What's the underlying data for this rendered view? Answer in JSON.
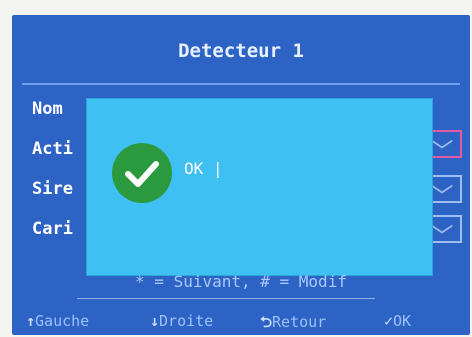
{
  "screen": {
    "title": "Detecteur 1",
    "rows": [
      {
        "label": "Nom"
      },
      {
        "label": "Acti"
      },
      {
        "label": "Sire"
      },
      {
        "label": "Cari"
      }
    ]
  },
  "dialog": {
    "message": "OK |",
    "icon": "check-circle-icon",
    "icon_color": "#2b9a3f"
  },
  "footer": {
    "hint": "* = Suivant, # = Modif",
    "nav": [
      {
        "glyph": "↑",
        "label": "Gauche"
      },
      {
        "glyph": "↓",
        "label": "Droite"
      },
      {
        "glyph": "⮌",
        "label": "Retour"
      },
      {
        "glyph": "✓",
        "label": "OK"
      }
    ]
  },
  "colors": {
    "screen_bg": "#2e63c6",
    "dialog_bg": "#3fc0f2",
    "selected_border": "#e05ca0"
  }
}
